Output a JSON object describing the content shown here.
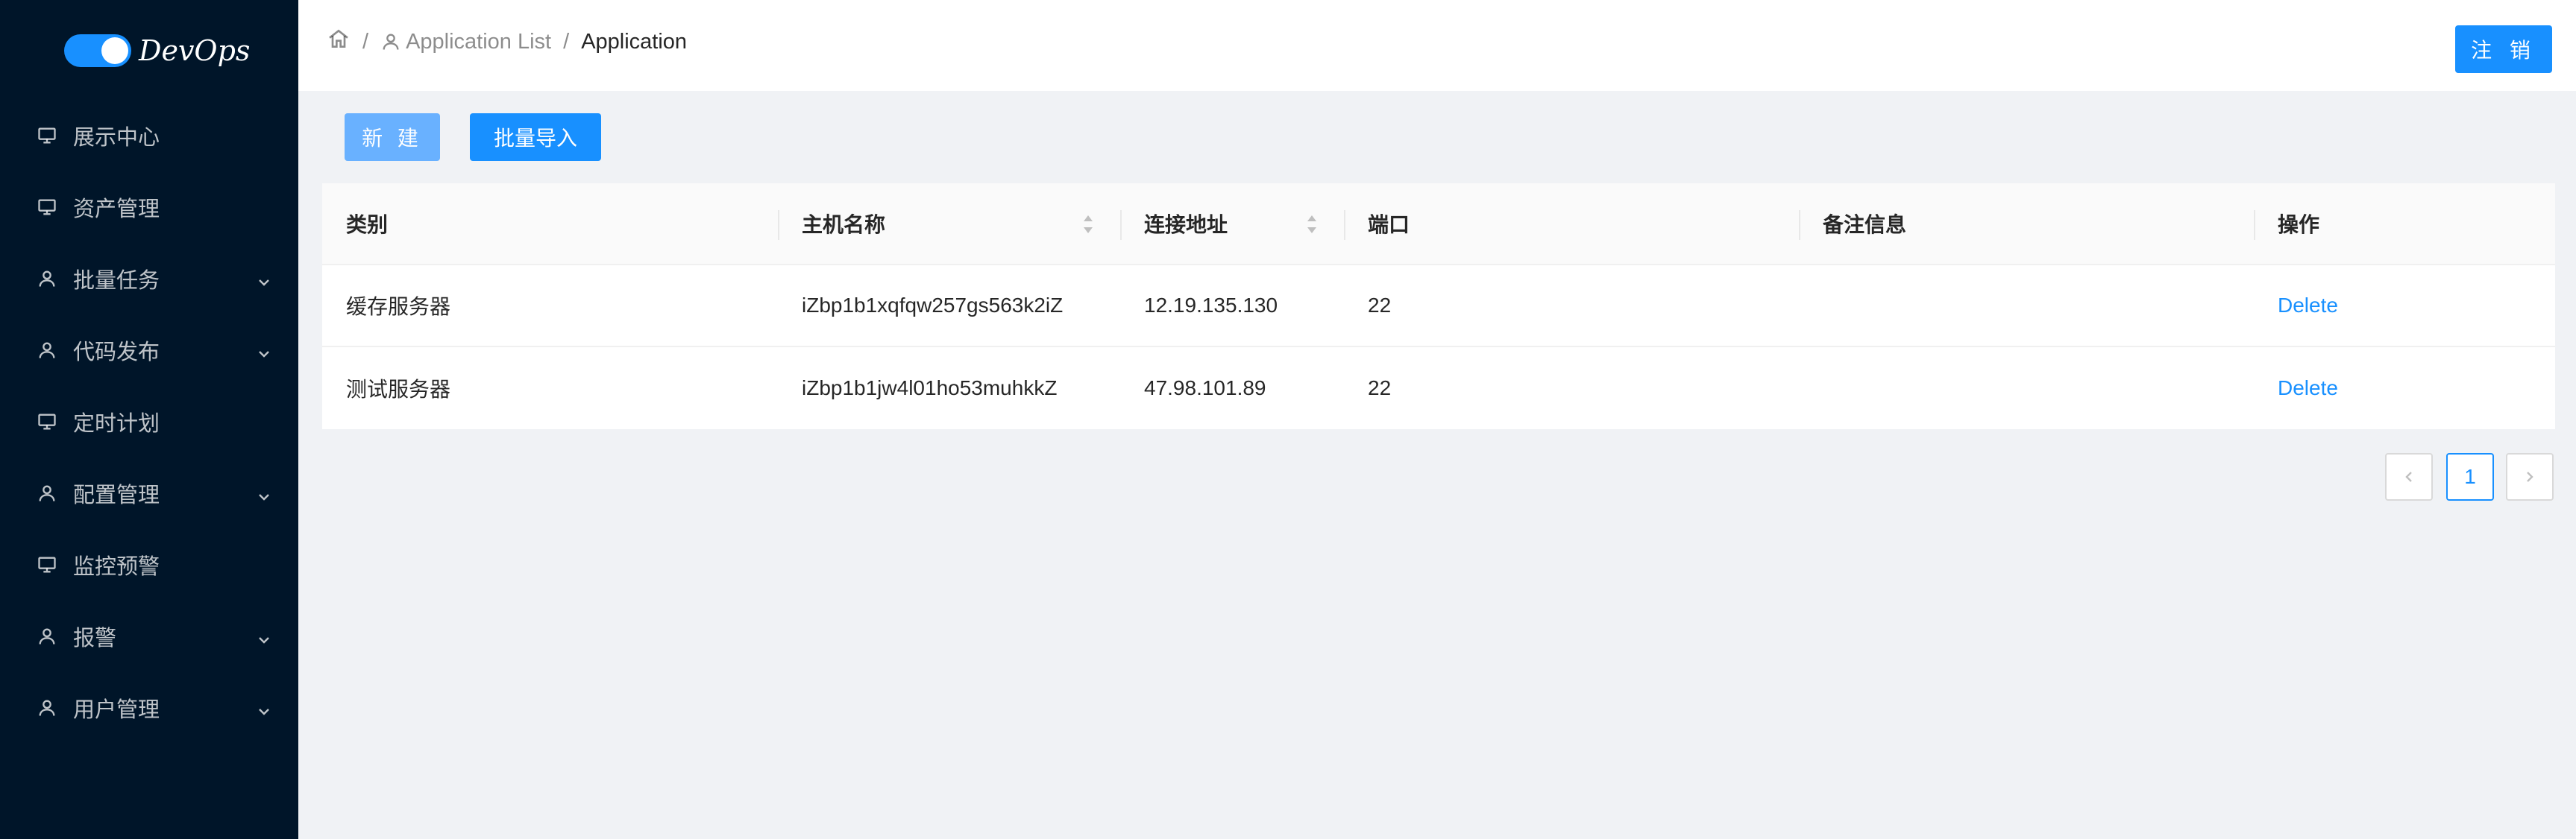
{
  "app": {
    "logo_text": "DevOps"
  },
  "sidebar": {
    "items": [
      {
        "label": "展示中心",
        "icon": "desktop-icon",
        "expandable": false
      },
      {
        "label": "资产管理",
        "icon": "desktop-icon",
        "expandable": false
      },
      {
        "label": "批量任务",
        "icon": "user-icon",
        "expandable": true
      },
      {
        "label": "代码发布",
        "icon": "user-icon",
        "expandable": true
      },
      {
        "label": "定时计划",
        "icon": "desktop-icon",
        "expandable": false
      },
      {
        "label": "配置管理",
        "icon": "user-icon",
        "expandable": true
      },
      {
        "label": "监控预警",
        "icon": "desktop-icon",
        "expandable": false
      },
      {
        "label": "报警",
        "icon": "user-icon",
        "expandable": true
      },
      {
        "label": "用户管理",
        "icon": "user-icon",
        "expandable": true
      }
    ]
  },
  "header": {
    "breadcrumb": {
      "separator": "/",
      "list": "Application List",
      "current": "Application"
    },
    "logout_label": "注 销"
  },
  "toolbar": {
    "new_label": "新 建",
    "import_label": "批量导入"
  },
  "table": {
    "columns": [
      "类别",
      "主机名称",
      "连接地址",
      "端口",
      "备注信息",
      "操作"
    ],
    "rows": [
      {
        "category": "缓存服务器",
        "hostname": "iZbp1b1xqfqw257gs563k2iZ",
        "address": "12.19.135.130",
        "port": "22",
        "remark": "",
        "action": "Delete"
      },
      {
        "category": "测试服务器",
        "hostname": "iZbp1b1jw4l01ho53muhkkZ",
        "address": "47.98.101.89",
        "port": "22",
        "remark": "",
        "action": "Delete"
      }
    ]
  },
  "pagination": {
    "current_page": "1"
  },
  "colors": {
    "sidebar_bg": "#001529",
    "primary": "#1890ff",
    "page_bg": "#f0f2f5"
  }
}
